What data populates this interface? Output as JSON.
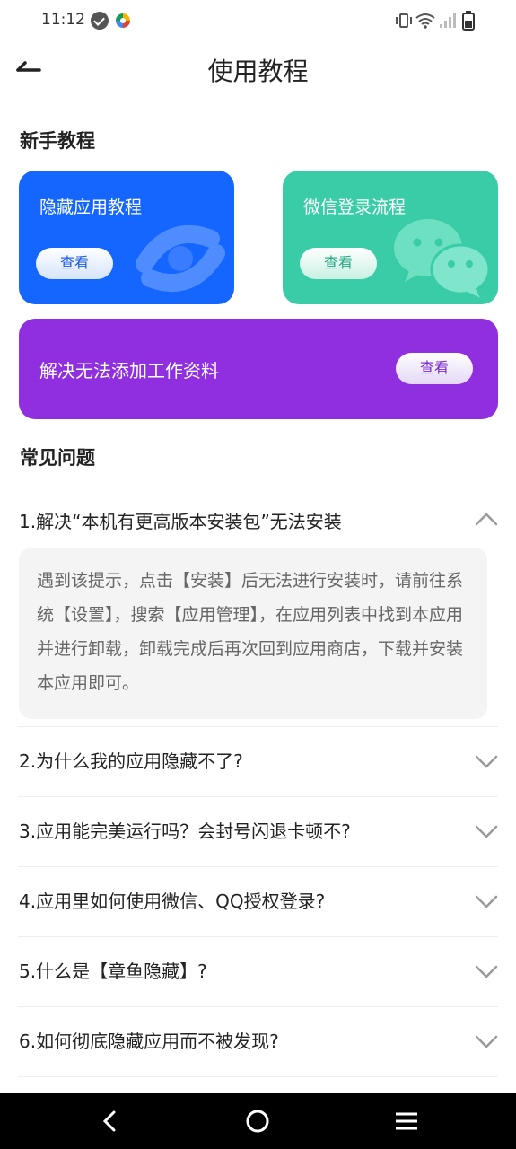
{
  "status_bar": {
    "time": "11:12"
  },
  "header": {
    "title": "使用教程"
  },
  "beginner": {
    "heading": "新手教程",
    "cards": [
      {
        "title": "隐藏应用教程",
        "button": "查看"
      },
      {
        "title": "微信登录流程",
        "button": "查看"
      },
      {
        "title": "解决无法添加工作资料",
        "button": "查看"
      }
    ]
  },
  "faq": {
    "heading": "常见问题",
    "items": [
      {
        "question": "1.解决“本机有更高版本安装包”无法安装",
        "expanded": true,
        "answer": "遇到该提示，点击【安装】后无法进行安装时，请前往系统【设置】，搜索【应用管理】，在应用列表中找到本应用并进行卸载，卸载完成后再次回到应用商店，下载并安装本应用即可。"
      },
      {
        "question": "2.为什么我的应用隐藏不了?",
        "expanded": false
      },
      {
        "question": "3.应用能完美运行吗？会封号闪退卡顿不?",
        "expanded": false
      },
      {
        "question": "4.应用里如何使用微信、QQ授权登录?",
        "expanded": false
      },
      {
        "question": "5.什么是【章鱼隐藏】?",
        "expanded": false
      },
      {
        "question": "6.如何彻底隐藏应用而不被发现?",
        "expanded": false
      }
    ]
  },
  "icons": {
    "back": "back-arrow-icon",
    "chevron_up": "chevron-up-icon",
    "chevron_down": "chevron-down-icon",
    "eye_slash": "eye-slash-icon",
    "wechat": "wechat-icon"
  },
  "colors": {
    "blue_card": "#1566ff",
    "green_card": "#39cca6",
    "purple_card": "#8f2fe0"
  }
}
